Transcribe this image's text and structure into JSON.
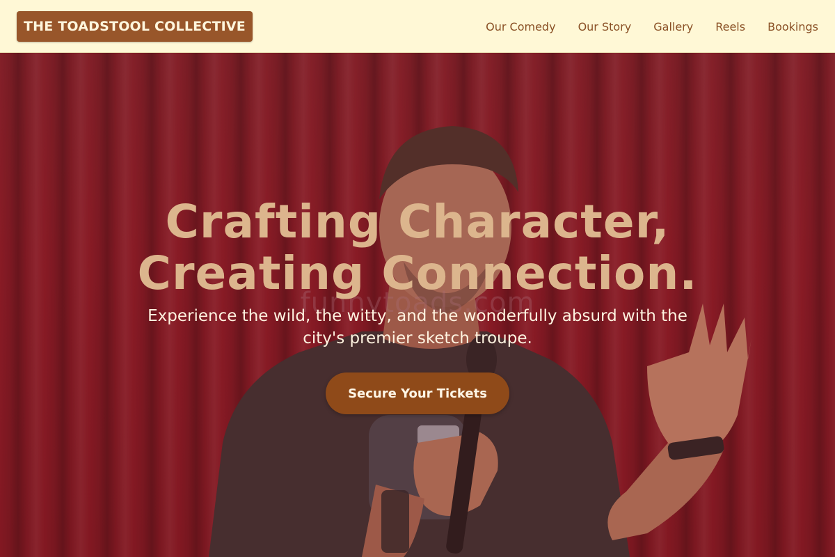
{
  "header": {
    "brand": "THE TOADSTOOL COLLECTIVE",
    "nav": [
      "Our Comedy",
      "Our Story",
      "Gallery",
      "Reels",
      "Bookings"
    ]
  },
  "hero": {
    "headline_line1": "Crafting Character,",
    "headline_line2": "Creating Connection.",
    "subtitle_line1": "Experience the wild, the witty, and the wonderfully absurd with the",
    "subtitle_line2": "city's premier sketch troupe.",
    "cta": "Secure Your Tickets",
    "watermark": "funnytoads.com"
  },
  "colors": {
    "header_bg": "#fff8d6",
    "brand_bg": "#98562a",
    "nav_text": "#8a5025",
    "curtain": "#87202a",
    "headline": "#dcb58d",
    "cta_bg": "#8f4a19"
  }
}
